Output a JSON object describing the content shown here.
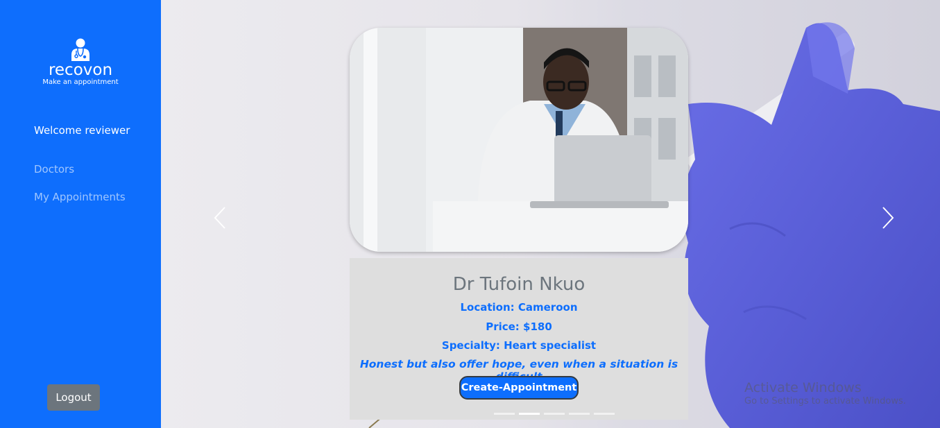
{
  "sidebar": {
    "brand": "recovon",
    "tagline": "Make an appointment",
    "welcome": "Welcome reviewer",
    "nav": {
      "doctors": "Doctors",
      "appointments": "My Appointments"
    },
    "logout": "Logout",
    "logo_icon": "doctor-icon"
  },
  "carousel": {
    "doctor": {
      "name": "Dr Tufoin Nkuo",
      "location": "Location: Cameroon",
      "price": "Price: $180",
      "specialty": "Specialty: Heart specialist",
      "quote": "Honest but also offer hope, even when a situation is difficult"
    },
    "cta": "Create-Appointment",
    "slide_count": 5,
    "active_slide": 2,
    "prev_icon": "chevron-left-icon",
    "next_icon": "chevron-right-icon"
  },
  "watermark": {
    "title": "Activate Windows",
    "subtitle": "Go to Settings to activate Windows."
  },
  "colors": {
    "sidebar_bg": "#0e6efd",
    "accent": "#0d6efd",
    "logout_bg": "#6c757d",
    "caption_bg": "#dedede"
  }
}
